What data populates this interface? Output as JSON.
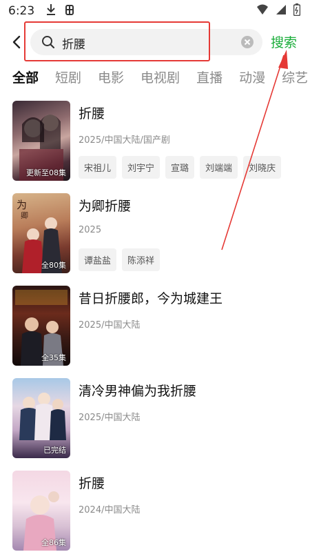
{
  "status_bar": {
    "time": "6:23",
    "left_icons": [
      "download-icon",
      "bug-icon"
    ],
    "right_icons": [
      "signal-icon",
      "wifi-icon",
      "battery-icon"
    ]
  },
  "search": {
    "query": "折腰",
    "button_label": "搜索",
    "accent_color": "#1aad3a"
  },
  "tabs": [
    {
      "label": "全部",
      "active": true
    },
    {
      "label": "短剧",
      "active": false
    },
    {
      "label": "电影",
      "active": false
    },
    {
      "label": "电视剧",
      "active": false
    },
    {
      "label": "直播",
      "active": false
    },
    {
      "label": "动漫",
      "active": false
    },
    {
      "label": "综艺",
      "active": false
    }
  ],
  "results": [
    {
      "title": "折腰",
      "meta": "2025/中国大陆/国产剧",
      "poster_label": "更新至08集",
      "cast": [
        "宋祖儿",
        "刘宇宁",
        "宣璐",
        "刘端端",
        "刘晓庆"
      ]
    },
    {
      "title": "为卿折腰",
      "meta": "2025",
      "poster_label": "全80集",
      "cast": [
        "谭盐盐",
        "陈添祥"
      ]
    },
    {
      "title": "昔日折腰郎，今为城建王",
      "meta": "2025/中国大陆",
      "poster_label": "全35集",
      "cast": []
    },
    {
      "title": "清冷男神偏为我折腰",
      "meta": "2025/中国大陆",
      "poster_label": "已完结",
      "cast": []
    },
    {
      "title": "折腰",
      "meta": "2024/中国大陆",
      "poster_label": "全86集",
      "cast": []
    }
  ],
  "annotation": {
    "highlight_color": "#e53935"
  }
}
